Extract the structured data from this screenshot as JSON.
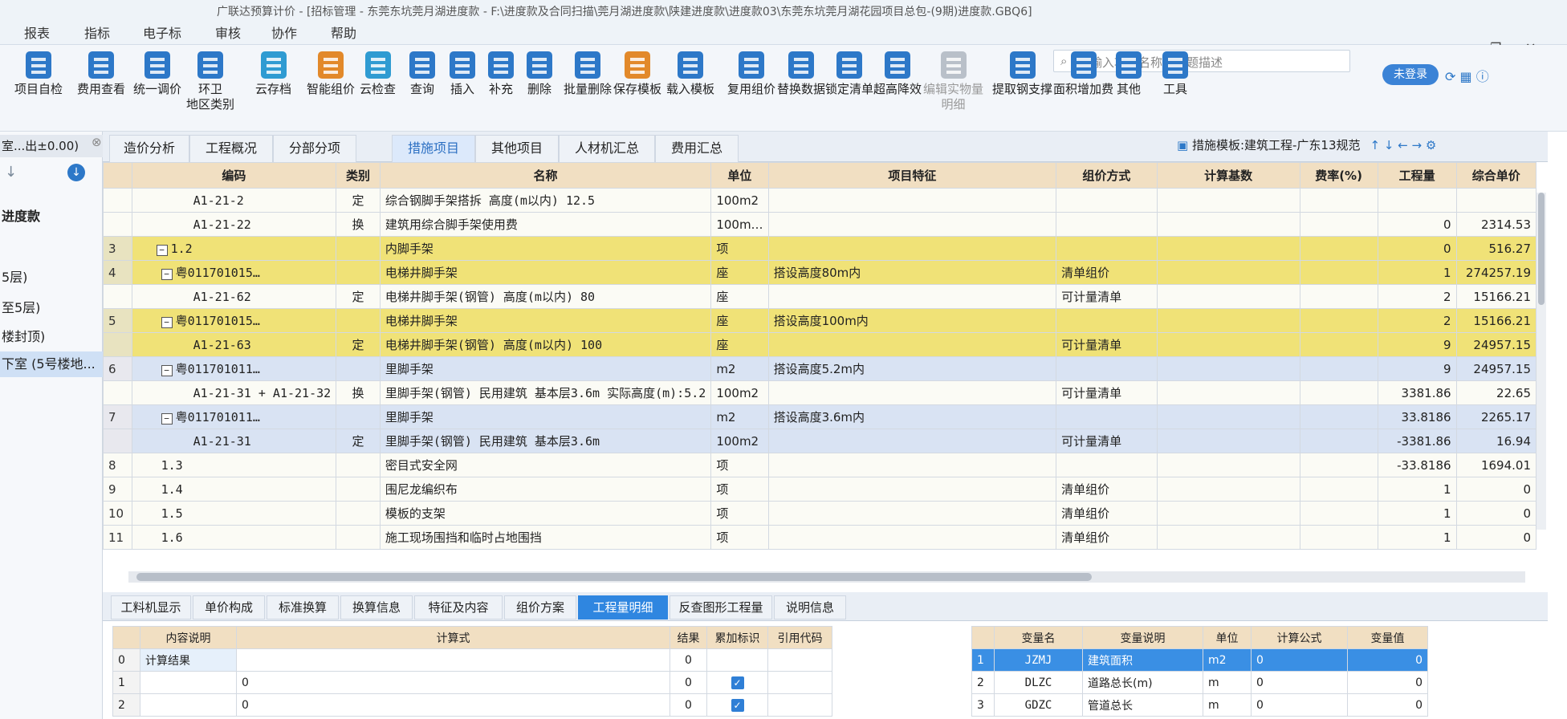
{
  "window": {
    "title": "广联达预算计价 - [招标管理 - 东莞东坑莞月湖进度款 - F:\\进度款及合同扫描\\莞月湖进度款\\陕建进度款\\进度款03\\东莞东坑莞月湖花园项目总包-(9期)进度款.GBQ6]"
  },
  "menu": [
    "报表",
    "指标",
    "电子标",
    "审核",
    "协作",
    "帮助"
  ],
  "search": {
    "placeholder": "请输入功能名称或问题描述"
  },
  "login_label": "未登录",
  "toolbar": [
    {
      "label": "项目自检",
      "icon": "check-icon",
      "color": "blue"
    },
    {
      "label": "费用查看",
      "icon": "cost-icon",
      "color": "blue"
    },
    {
      "label": "统一调价",
      "icon": "adjust-icon",
      "color": "blue"
    },
    {
      "label": "环卫\n地区类别",
      "icon": "region-icon",
      "color": "blue"
    },
    {
      "label": "云存档",
      "icon": "cloud-icon",
      "color": "teal"
    },
    {
      "label": "智能组价",
      "icon": "smart-icon",
      "color": "orange"
    },
    {
      "label": "云检查",
      "icon": "cloud-check-icon",
      "color": "teal"
    },
    {
      "label": "查询",
      "icon": "query-icon",
      "color": "blue"
    },
    {
      "label": "插入",
      "icon": "insert-icon",
      "color": "blue"
    },
    {
      "label": "补充",
      "icon": "supplement-icon",
      "color": "blue"
    },
    {
      "label": "删除",
      "icon": "delete-icon",
      "color": "blue"
    },
    {
      "label": "批量删除",
      "icon": "batch-delete-icon",
      "color": "blue"
    },
    {
      "label": "保存模板",
      "icon": "save-template-icon",
      "color": "orange"
    },
    {
      "label": "载入模板",
      "icon": "load-template-icon",
      "color": "blue"
    },
    {
      "label": "复用组价",
      "icon": "reuse-icon",
      "color": "blue"
    },
    {
      "label": "替换数据",
      "icon": "replace-icon",
      "color": "blue"
    },
    {
      "label": "锁定清单",
      "icon": "lock-icon",
      "color": "blue"
    },
    {
      "label": "超高降效",
      "icon": "height-icon",
      "color": "blue"
    },
    {
      "label": "编辑实物量\n明细",
      "icon": "edit-icon",
      "color": "grey"
    },
    {
      "label": "提取钢支撑",
      "icon": "steel-icon",
      "color": "blue"
    },
    {
      "label": "面积增加费",
      "icon": "area-icon",
      "color": "blue"
    },
    {
      "label": "其他",
      "icon": "other-icon",
      "color": "blue"
    },
    {
      "label": "工具",
      "icon": "tool-icon",
      "color": "blue"
    }
  ],
  "sidebar": {
    "header": "室...出±0.00)",
    "items": [
      "进度款",
      "5层)",
      "至5层)",
      "楼封顶)",
      "下室 (5号楼地..."
    ]
  },
  "tabs": [
    "造价分析",
    "工程概况",
    "分部分项",
    "措施项目",
    "其他项目",
    "人材机汇总",
    "费用汇总"
  ],
  "template_label": "措施模板:建筑工程-广东13规范",
  "grid": {
    "columns": [
      "编码",
      "类别",
      "名称",
      "单位",
      "项目特征",
      "组价方式",
      "计算基数",
      "费率(%)",
      "工程量",
      "综合单价"
    ],
    "rows": [
      {
        "no": "",
        "code": "A1-21-2",
        "type": "定",
        "name": "综合钢脚手架搭拆 高度(m以内) 12.5",
        "unit": "100m2",
        "feature": "",
        "method": "",
        "base": "",
        "rate": "",
        "qty": "",
        "price": "",
        "style": "wht"
      },
      {
        "no": "",
        "code": "A1-21-22",
        "type": "换",
        "name": "建筑用综合脚手架使用费",
        "unit": "100m…",
        "feature": "",
        "method": "",
        "base": "",
        "rate": "",
        "qty": "0",
        "price": "2314.53",
        "style": "wht"
      },
      {
        "no": "3",
        "code": "1.2",
        "type": "",
        "name": "内脚手架",
        "unit": "项",
        "feature": "",
        "method": "",
        "base": "",
        "rate": "",
        "qty": "0",
        "price": "516.27",
        "style": "yel"
      },
      {
        "no": "4",
        "code": "粤011701015…",
        "type": "",
        "name": "电梯井脚手架",
        "unit": "座",
        "feature": "搭设高度80m内",
        "method": "清单组价",
        "base": "",
        "rate": "",
        "qty": "1",
        "price": "274257.19",
        "style": "yel"
      },
      {
        "no": "",
        "code": "A1-21-62",
        "type": "定",
        "name": "电梯井脚手架(钢管) 高度(m以内) 80",
        "unit": "座",
        "feature": "",
        "method": "可计量清单",
        "base": "",
        "rate": "",
        "qty": "2",
        "price": "15166.21",
        "style": "wht"
      },
      {
        "no": "5",
        "code": "粤011701015…",
        "type": "",
        "name": "电梯井脚手架",
        "unit": "座",
        "feature": "搭设高度100m内",
        "method": "",
        "base": "",
        "rate": "",
        "qty": "2",
        "price": "15166.21",
        "style": "yel"
      },
      {
        "no": "",
        "code": "A1-21-63",
        "type": "定",
        "name": "电梯井脚手架(钢管) 高度(m以内) 100",
        "unit": "座",
        "feature": "",
        "method": "可计量清单",
        "base": "",
        "rate": "",
        "qty": "9",
        "price": "24957.15",
        "style": "yel"
      },
      {
        "no": "6",
        "code": "粤011701011…",
        "type": "",
        "name": "里脚手架",
        "unit": "m2",
        "feature": "搭设高度5.2m内",
        "method": "",
        "base": "",
        "rate": "",
        "qty": "9",
        "price": "24957.15",
        "style": "blu"
      },
      {
        "no": "",
        "code": "A1-21-31 + A1-21-32",
        "type": "换",
        "name": "里脚手架(钢管) 民用建筑 基本层3.6m 实际高度(m):5.2",
        "unit": "100m2",
        "feature": "",
        "method": "可计量清单",
        "base": "",
        "rate": "",
        "qty": "3381.86",
        "price": "22.65",
        "style": "wht"
      },
      {
        "no": "7",
        "code": "粤011701011…",
        "type": "",
        "name": "里脚手架",
        "unit": "m2",
        "feature": "搭设高度3.6m内",
        "method": "",
        "base": "",
        "rate": "",
        "qty": "33.8186",
        "price": "2265.17",
        "style": "blu"
      },
      {
        "no": "",
        "code": "A1-21-31",
        "type": "定",
        "name": "里脚手架(钢管) 民用建筑 基本层3.6m",
        "unit": "100m2",
        "feature": "",
        "method": "可计量清单",
        "base": "",
        "rate": "",
        "qty": "-3381.86",
        "price": "16.94",
        "style": "blu"
      },
      {
        "no": "8",
        "code": "1.3",
        "type": "",
        "name": "密目式安全网",
        "unit": "项",
        "feature": "",
        "method": "",
        "base": "",
        "rate": "",
        "qty": "-33.8186",
        "price": "1694.01",
        "style": "wht"
      },
      {
        "no": "9",
        "code": "1.4",
        "type": "",
        "name": "围尼龙编织布",
        "unit": "项",
        "feature": "",
        "method": "清单组价",
        "base": "",
        "rate": "",
        "qty": "1",
        "price": "0",
        "style": "wht"
      },
      {
        "no": "10",
        "code": "1.5",
        "type": "",
        "name": "模板的支架",
        "unit": "项",
        "feature": "",
        "method": "清单组价",
        "base": "",
        "rate": "",
        "qty": "1",
        "price": "0",
        "style": "wht"
      },
      {
        "no": "11",
        "code": "1.6",
        "type": "",
        "name": "施工现场围挡和临时占地围挡",
        "unit": "项",
        "feature": "",
        "method": "清单组价",
        "base": "",
        "rate": "",
        "qty": "1",
        "price": "0",
        "style": "wht"
      }
    ]
  },
  "bottom_tabs": [
    "工料机显示",
    "单价构成",
    "标准换算",
    "换算信息",
    "特征及内容",
    "组价方案",
    "工程量明细",
    "反查图形工程量",
    "说明信息"
  ],
  "calc_table": {
    "columns": [
      "内容说明",
      "计算式",
      "结果",
      "累加标识",
      "引用代码"
    ],
    "rows": [
      {
        "no": "0",
        "desc": "计算结果",
        "formula": "",
        "result": "0",
        "acc": false,
        "ref": ""
      },
      {
        "no": "1",
        "desc": "",
        "formula": "0",
        "result": "0",
        "acc": true,
        "ref": ""
      },
      {
        "no": "2",
        "desc": "",
        "formula": "0",
        "result": "0",
        "acc": true,
        "ref": ""
      }
    ]
  },
  "var_table": {
    "columns": [
      "变量名",
      "变量说明",
      "单位",
      "计算公式",
      "变量值"
    ],
    "rows": [
      {
        "no": "1",
        "name": "JZMJ",
        "desc": "建筑面积",
        "unit": "m2",
        "formula": "0",
        "value": "0",
        "selected": true
      },
      {
        "no": "2",
        "name": "DLZC",
        "desc": "道路总长(m)",
        "unit": "m",
        "formula": "0",
        "value": "0",
        "selected": false
      },
      {
        "no": "3",
        "name": "GDZC",
        "desc": "管道总长",
        "unit": "m",
        "formula": "0",
        "value": "0",
        "selected": false
      }
    ]
  }
}
